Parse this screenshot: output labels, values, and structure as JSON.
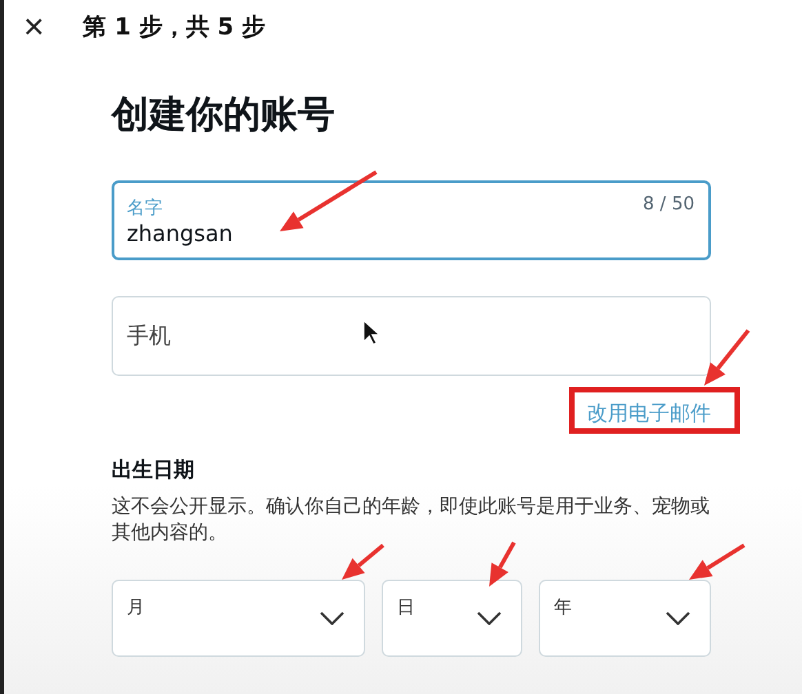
{
  "header": {
    "close": "×",
    "step": "第 1 步，共 5 步"
  },
  "title": "创建你的账号",
  "fields": [
    {
      "kind": "text",
      "label": "名字",
      "value": "zhangsan",
      "counter": "8 / 50",
      "focused": true
    },
    {
      "kind": "text",
      "placeholder": "手机",
      "focused": false
    }
  ],
  "switch_link": "改用电子邮件",
  "birth": {
    "title": "出生日期",
    "description": "这不会公开显示。确认你自己的年龄，即使此账号是用于业务、宠物或其他内容的。",
    "selects": [
      {
        "label": "月"
      },
      {
        "label": "日"
      },
      {
        "label": "年"
      }
    ]
  }
}
